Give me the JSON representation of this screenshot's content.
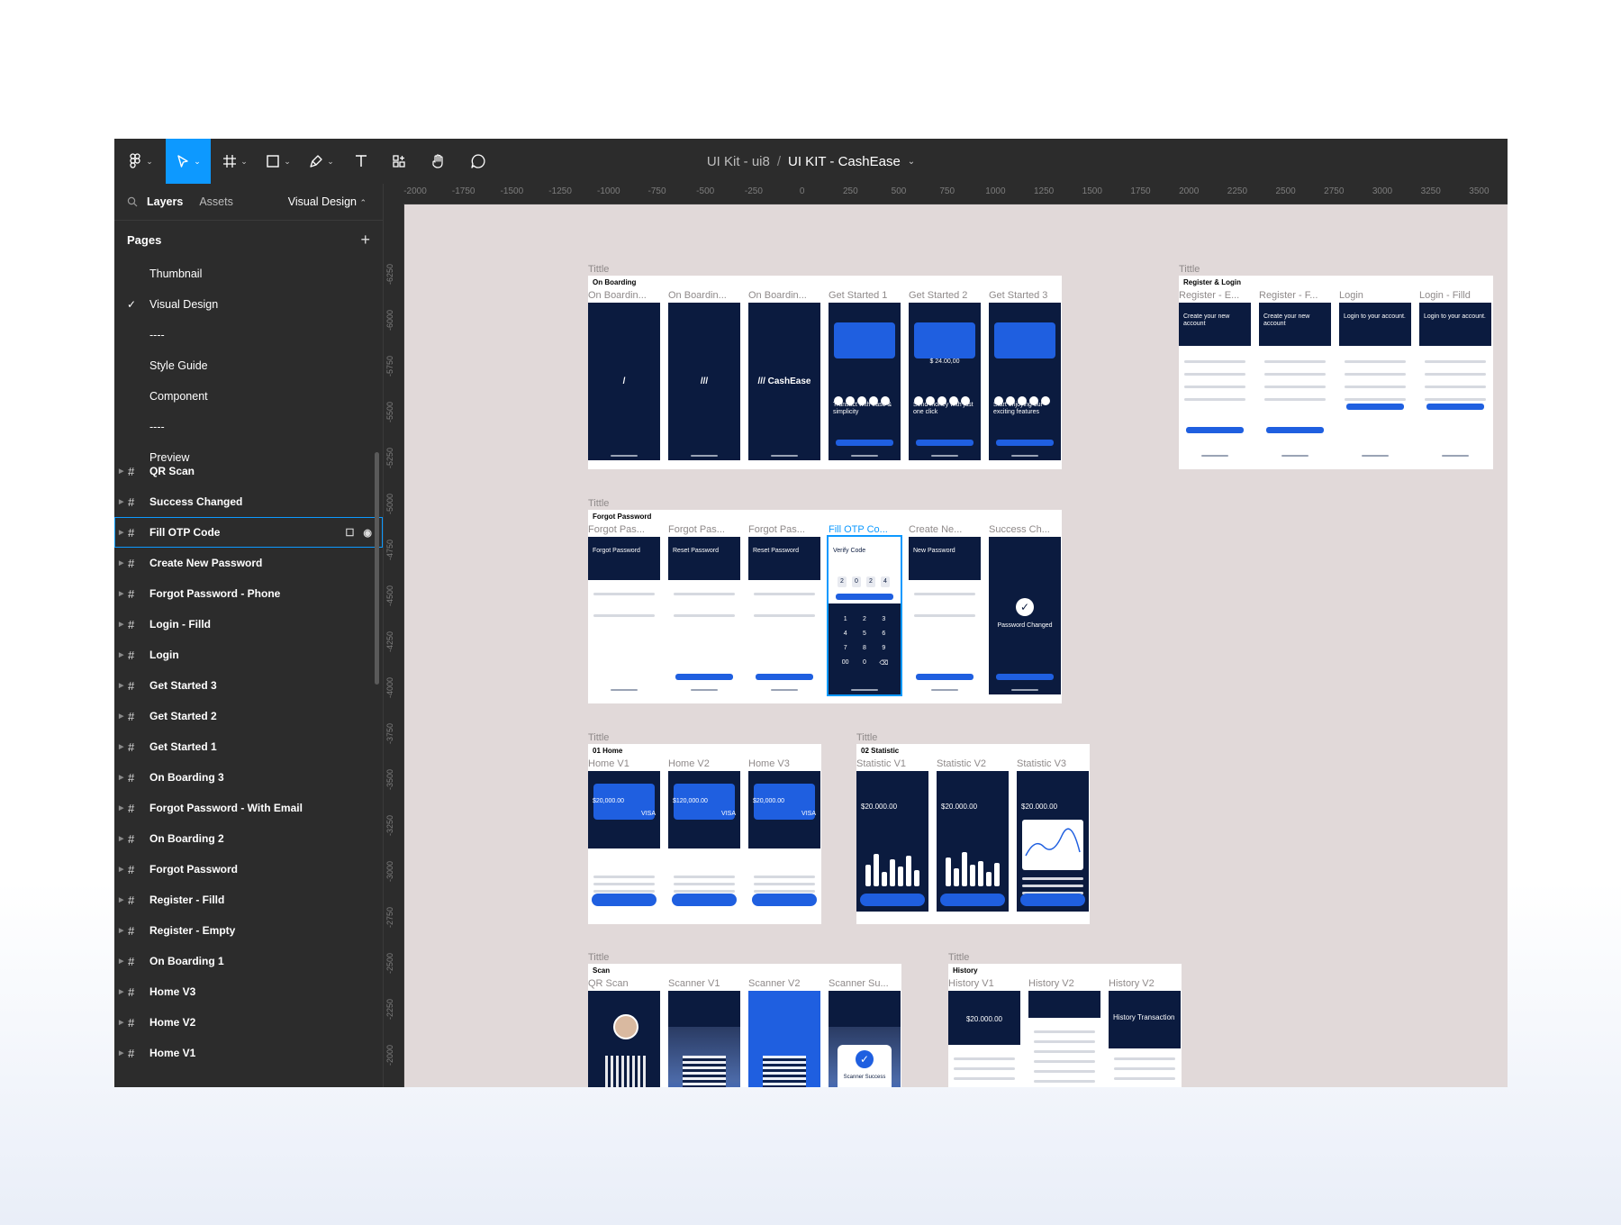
{
  "window": {
    "project": "UI Kit - ui8",
    "separator": "/",
    "file": "UI KIT - CashEase"
  },
  "toolbar": {
    "tools": [
      "figma-menu",
      "move-tool",
      "frame-tool",
      "shape-tool",
      "pen-tool",
      "text-tool",
      "resources-tool",
      "hand-tool",
      "comment-tool"
    ]
  },
  "sidebar": {
    "tabs": {
      "layers": "Layers",
      "assets": "Assets",
      "page_selector": "Visual Design"
    },
    "pages_header": "Pages",
    "pages": [
      {
        "label": "Thumbnail",
        "checked": false
      },
      {
        "label": "Visual Design",
        "checked": true
      },
      {
        "label": "----",
        "checked": false
      },
      {
        "label": "Style Guide",
        "checked": false
      },
      {
        "label": "Component",
        "checked": false
      },
      {
        "label": "----",
        "checked": false
      },
      {
        "label": "Preview",
        "checked": false
      }
    ],
    "layers": [
      "QR Scan",
      "Success Changed",
      "Fill OTP Code",
      "Create New Password",
      "Forgot Password - Phone",
      "Login - Filld",
      "Login",
      "Get Started 3",
      "Get Started 2",
      "Get Started 1",
      "On Boarding 3",
      "Forgot Password - With Email",
      "On Boarding 2",
      "Forgot Password",
      "Register - Filld",
      "Register - Empty",
      "On Boarding 1",
      "Home V3",
      "Home V2",
      "Home V1"
    ],
    "selected_layer": "Fill OTP Code"
  },
  "ruler": {
    "top": [
      "-2000",
      "-1750",
      "-1500",
      "-1250",
      "-1000",
      "-750",
      "-500",
      "-250",
      "0",
      "250",
      "500",
      "750",
      "1000",
      "1250",
      "1500",
      "1750",
      "2000",
      "2250",
      "2500",
      "2750",
      "3000",
      "3250",
      "3500"
    ],
    "left": [
      "-6250",
      "-6000",
      "-5750",
      "-5500",
      "-5250",
      "-5000",
      "-4750",
      "-4500",
      "-4250",
      "-4000",
      "-3750",
      "-3500",
      "-3250",
      "-3000",
      "-2750",
      "-2500",
      "-2250",
      "-2000"
    ]
  },
  "canvas": {
    "sections": {
      "onboarding": {
        "title": "Tittle",
        "board": "On Boarding",
        "frames": [
          "On Boardin...",
          "On Boardin...",
          "On Boardin...",
          "Get Started 1",
          "Get Started 2",
          "Get Started 3"
        ],
        "texts": [
          "/",
          "///",
          "/// CashEase",
          "Transact with ease & simplicity",
          "Send money with just one click",
          "Start enjoying our exciting features"
        ],
        "amount": "$ 24.00,00"
      },
      "register": {
        "title": "Tittle",
        "board": "Register & Login",
        "frames": [
          "Register - E...",
          "Register - F...",
          "Login",
          "Login - Filld"
        ],
        "texts": [
          "Create your new account",
          "Create your new account",
          "Login to your account.",
          "Login to your account."
        ]
      },
      "forgot": {
        "title": "Tittle",
        "board": "Forgot Password",
        "frames": [
          "Forgot Pas...",
          "Forgot Pas...",
          "Forgot Pas...",
          "Fill OTP Co...",
          "Create Ne...",
          "Success Ch..."
        ],
        "texts": [
          "Forgot Password",
          "Reset Password",
          "Reset Password",
          "Verify Code",
          "New Password",
          "Password Changed"
        ],
        "otp": [
          "2",
          "0",
          "2",
          "4"
        ],
        "keypad": [
          "1",
          "2",
          "3",
          "4",
          "5",
          "6",
          "7",
          "8",
          "9",
          "00",
          "0",
          "⌫"
        ]
      },
      "home": {
        "title": "Tittle",
        "board": "01 Home",
        "frames": [
          "Home V1",
          "Home V2",
          "Home V3"
        ],
        "balances": [
          "$20,000.00",
          "$120,000.00",
          "$20,000.00"
        ],
        "card": "VISA"
      },
      "statistic": {
        "title": "Tittle",
        "board": "02 Statistic",
        "frames": [
          "Statistic V1",
          "Statistic V2",
          "Statistic V3"
        ],
        "amounts": [
          "$20.000.00",
          "$20.000.00",
          "$20.000.00"
        ]
      },
      "scan": {
        "title": "Tittle",
        "board": "Scan",
        "frames": [
          "QR Scan",
          "Scanner V1",
          "Scanner V2",
          "Scanner Su..."
        ],
        "success": "Scanner Success"
      },
      "history": {
        "title": "Tittle",
        "board": "History",
        "frames": [
          "History V1",
          "History V2",
          "History V2"
        ],
        "amount": "$20.000.00",
        "heading": "History Transaction"
      }
    }
  },
  "colors": {
    "accent": "#0d99ff",
    "navy": "#0b1b3f",
    "brand_blue": "#1f5fe0",
    "canvas": "#e1d9d9"
  }
}
